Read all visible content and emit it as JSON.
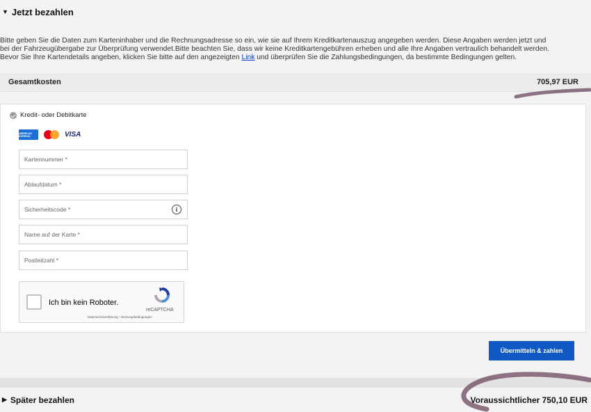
{
  "pay_now": {
    "title": "Jetzt bezahlen",
    "info_line1": "Bitte geben Sie die Daten zum Karteninhaber und die Rechnungsadresse so ein, wie sie auf Ihrem Kreditkartenauszug angegeben werden. Diese Angaben werden jetzt und",
    "info_line2": "bei der Fahrzeugübergabe zur Überprüfung verwendet.Bitte beachten Sie, dass wir keine Kreditkartengebühren erheben und alle Ihre Angaben vertraulich behandelt werden.",
    "info_line3_before": "Bevor Sie Ihre Kartendetails angeben, klicken Sie bitte auf den angezeigten ",
    "info_link": "Link",
    "info_line3_after": " und überprüfen Sie die Zahlungsbedingungen, da bestimmte Bedingungen gelten."
  },
  "total": {
    "label": "Gesamtkosten",
    "amount": "705,97 EUR"
  },
  "payment_method": {
    "label": "Kredit- oder Debitkarte",
    "card_logos": [
      "amex-icon",
      "mastercard-icon",
      "visa-icon"
    ],
    "amex_text": "AMERICAN EXPRESS",
    "visa_text": "VISA"
  },
  "fields": {
    "card_number": "Kartennummer *",
    "expiry": "Ablaufdatum *",
    "security_code": "Sicherheitscode *",
    "security_info": "i",
    "name_on_card": "Name auf der Karte *",
    "postcode": "Postleitzahl *"
  },
  "captcha": {
    "label": "Ich bin kein Roboter.",
    "brand": "reCAPTCHA",
    "links": "Datenschutzerklärung - Nutzungsbedingungen"
  },
  "submit_label": "Übermitteln & zahlen",
  "pay_later": {
    "title": "Später bezahlen",
    "estimate": "Voraussichtlicher 750,10 EUR"
  },
  "colors": {
    "accent": "#1059c4",
    "link": "#0a3fd8",
    "annotation": "#7a5a6e"
  }
}
